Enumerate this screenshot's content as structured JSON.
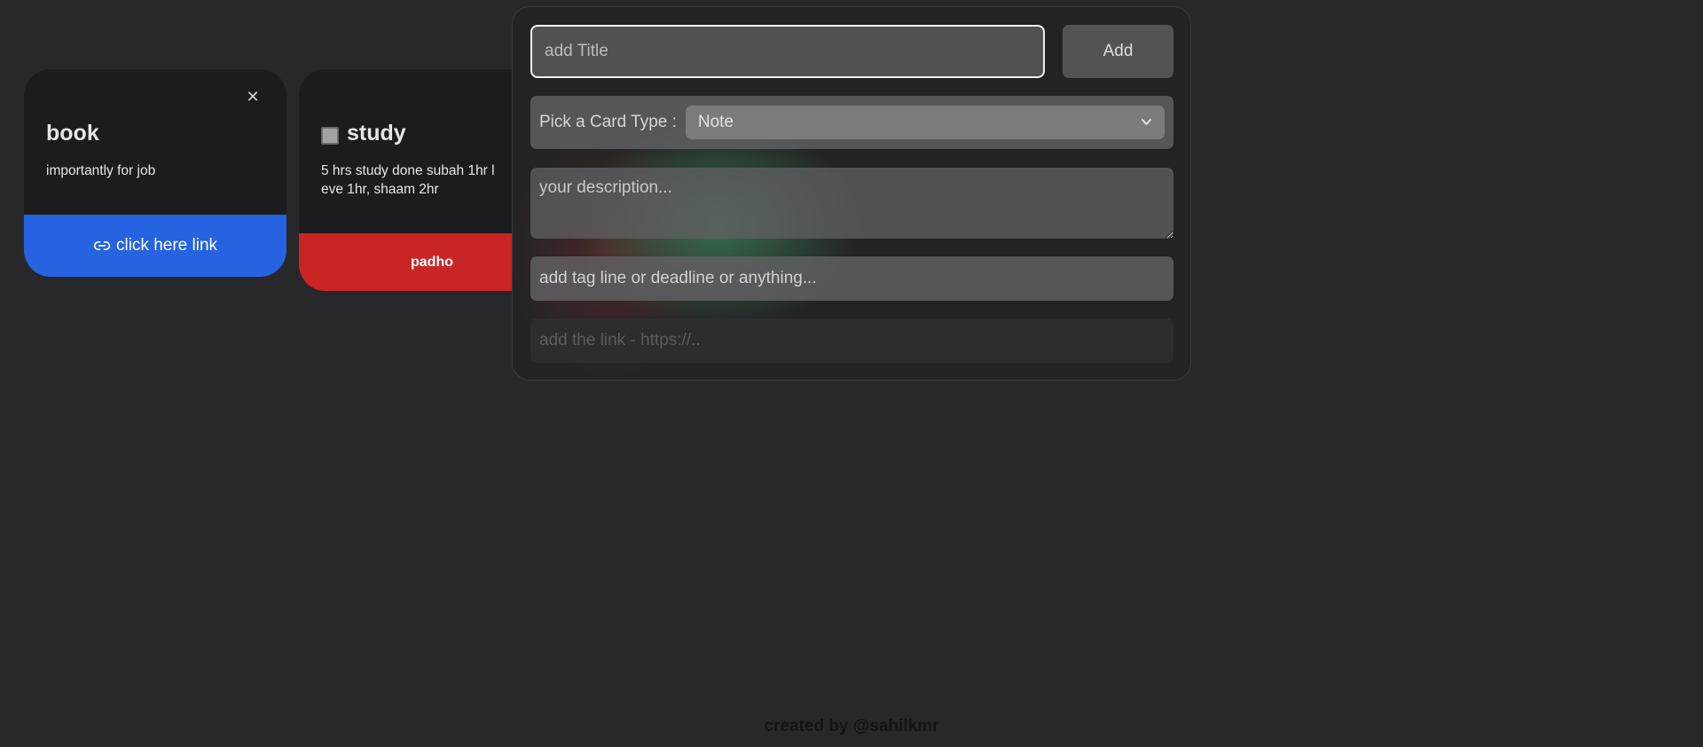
{
  "cards": [
    {
      "title": "book",
      "description": "importantly for job",
      "footer_label": "click here link",
      "footer_icon": "link-icon",
      "close_icon": "close-icon",
      "footer_color": "#2563e0"
    },
    {
      "title": "study",
      "description_line1": "5 hrs study done subah 1hr l",
      "description_line2": "eve 1hr, shaam 2hr",
      "footer_label": "padho",
      "footer_color": "#c92524"
    }
  ],
  "form": {
    "title_placeholder": "add Title",
    "title_value": "",
    "add_label": "Add",
    "type_label": "Pick a Card Type :",
    "type_selected": "Note",
    "description_placeholder": "your description...",
    "tag_placeholder": "add tag line or deadline or anything...",
    "link_placeholder": "add the link - https://.."
  },
  "footer": {
    "credit": "created by @sahilkmr"
  }
}
